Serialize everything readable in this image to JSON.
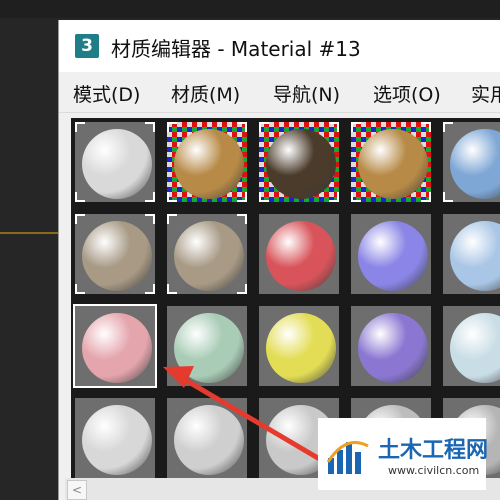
{
  "window": {
    "app_icon_label": "3",
    "title": "材质编辑器 - Material #13"
  },
  "menu": [
    {
      "label": "模式(D)"
    },
    {
      "label": "材质(M)"
    },
    {
      "label": "导航(N)"
    },
    {
      "label": "选项(O)"
    },
    {
      "label": "实用"
    }
  ],
  "material_slots": [
    {
      "material": "white-gray",
      "color": "#d9d9d9",
      "background": "gray",
      "active": true
    },
    {
      "material": "reflective-map",
      "color": "#b78a47",
      "background": "checker",
      "active": true
    },
    {
      "material": "dark-wood",
      "color": "#4a3b2a",
      "background": "checker",
      "active": true
    },
    {
      "material": "reflective-map",
      "color": "#b78a47",
      "background": "checker",
      "active": true
    },
    {
      "material": "sky-reflection",
      "color": "#7fa7d6",
      "background": "gray",
      "active": true
    },
    {
      "material": "environment-map",
      "color": "#a89a85",
      "background": "gray",
      "active": true
    },
    {
      "material": "environment-map",
      "color": "#a89a85",
      "background": "gray",
      "active": true
    },
    {
      "material": "red",
      "color": "#d8545a",
      "background": "gray",
      "active": false
    },
    {
      "material": "purple-blue",
      "color": "#8a85e6",
      "background": "gray",
      "active": false
    },
    {
      "material": "light-blue",
      "color": "#a9c6e6",
      "background": "gray",
      "active": false
    },
    {
      "material": "pink",
      "color": "#e5a5ad",
      "background": "gray",
      "active": false,
      "selected": true
    },
    {
      "material": "mint-green",
      "color": "#a9ccb6",
      "background": "gray",
      "active": false
    },
    {
      "material": "yellow",
      "color": "#e3dd55",
      "background": "gray",
      "active": false
    },
    {
      "material": "violet",
      "color": "#8b77d2",
      "background": "gray",
      "active": false
    },
    {
      "material": "pale-cyan",
      "color": "#c9dde6",
      "background": "gray",
      "active": false
    },
    {
      "material": "default-gray",
      "color": "#d8d8d8",
      "background": "gray",
      "active": false
    },
    {
      "material": "default-gray",
      "color": "#cfcfcf",
      "background": "gray",
      "active": false
    },
    {
      "material": "default-gray",
      "color": "#c9c9c9",
      "background": "gray",
      "active": false
    },
    {
      "material": "default-gray",
      "color": "#bdbdbd",
      "background": "gray",
      "active": false
    },
    {
      "material": "default-gray",
      "color": "#b5b5b5",
      "background": "gray",
      "active": false
    }
  ],
  "scrollbar": {
    "left_arrow": "<"
  },
  "watermark": {
    "title": "土木工程网",
    "url": "www.civilcn.com"
  },
  "colors": {
    "annotation_arrow": "#e53a2e",
    "watermark_blue": "#1b66b3"
  }
}
